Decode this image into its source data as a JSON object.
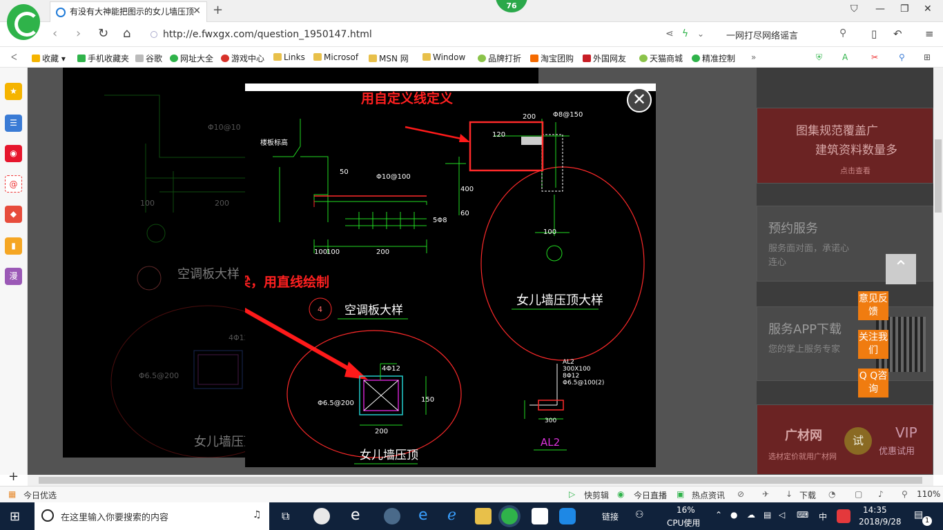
{
  "browser": {
    "tab_title": "有没有大神能把图示的女儿墙压顶",
    "notification_count": "76",
    "url": "http://e.fwxgx.com/question_1950147.html",
    "search_hint": "一网打尽网络谣言"
  },
  "bookmarks": [
    {
      "label": "收藏",
      "icon": "star-icon",
      "color": "#f5b400"
    },
    {
      "label": "手机收藏夹",
      "icon": "phone-icon",
      "color": "#2fb34a"
    },
    {
      "label": "谷歌",
      "icon": "page-icon",
      "color": "#bbbbbb"
    },
    {
      "label": "网址大全",
      "icon": "globe-icon",
      "color": "#2fb34a"
    },
    {
      "label": "游戏中心",
      "icon": "game-icon",
      "color": "#d8322a"
    },
    {
      "label": "Links",
      "icon": "folder-icon",
      "color": "#e8c04a"
    },
    {
      "label": "Microsof",
      "icon": "folder-icon",
      "color": "#e8c04a"
    },
    {
      "label": "MSN 网",
      "icon": "folder-icon",
      "color": "#e8c04a"
    },
    {
      "label": "Window",
      "icon": "folder-icon",
      "color": "#e8c04a"
    },
    {
      "label": "品牌打折",
      "icon": "leaf-icon",
      "color": "#8bc34a"
    },
    {
      "label": "淘宝团购",
      "icon": "taobao-icon",
      "color": "#f56a00"
    },
    {
      "label": "外国网友",
      "icon": "bookmark-icon",
      "color": "#c81d25"
    },
    {
      "label": "天猫商城",
      "icon": "leaf-icon",
      "color": "#8bc34a"
    },
    {
      "label": "精准控制",
      "icon": "chat-icon",
      "color": "#2fb34a"
    }
  ],
  "sidebar": [
    {
      "icon": "favorites-star-icon",
      "color": "#f5b400",
      "glyph": "★"
    },
    {
      "icon": "news-icon",
      "color": "#3a7bd5",
      "glyph": "☰"
    },
    {
      "icon": "weibo-icon",
      "color": "#e6162d",
      "glyph": "◉"
    },
    {
      "icon": "mail-icon",
      "color": "#ffffff",
      "glyph": "@"
    },
    {
      "icon": "games-icon",
      "color": "#e74c3c",
      "glyph": "◆"
    },
    {
      "icon": "reader-icon",
      "color": "#f5a623",
      "glyph": "▮"
    },
    {
      "icon": "comic-icon",
      "color": "#9b59b6",
      "glyph": "漫"
    }
  ],
  "right_column": {
    "banner1_line1": "图集规范覆盖广",
    "banner1_line2": "建筑资料数量多",
    "banner1_cta": "点击查看",
    "card1_title": "预约服务",
    "card1_sub": "服务面对面，承诺心连心",
    "card2_title": "服务APP下载",
    "card2_sub": "您的掌上服务专家",
    "banner2_brand": "广材网",
    "banner2_sub": "选材定价就用广材网",
    "banner2_badge": "试",
    "banner2_vip": "VIP",
    "banner2_vip_sub": "优惠试用"
  },
  "float_buttons": {
    "feedback": "意见反馈",
    "follow": "关注我们",
    "qq": "Q Q咨询"
  },
  "drawing": {
    "note_custom_line": "用自定义线定义",
    "note_ring_beam": "定义圈梁，用直线绘制",
    "title_parapet_detail": "女儿墙压顶大样",
    "title_ac_panel": "空调板大样",
    "title_parapet_top": "女儿墙压顶",
    "title_al2": "AL2",
    "detail_no": "4",
    "rebar_top": "Φ8@150",
    "rebar_ac": "Φ10@100",
    "rebar_ac_bg": "Φ10@10",
    "rebar_stirrup": "Φ6.5@200",
    "rebar_main": "4Φ12",
    "dim_200": "200",
    "dim_100a": "100",
    "dim_100b": "100",
    "dim_400": "400",
    "dim_60": "60",
    "dim_120": "120",
    "dim_150": "150",
    "dim_300": "300",
    "dim_50": "50",
    "dim_small": "5Φ8",
    "al2_spec1": "AL2",
    "al2_spec2": "300X100",
    "al2_spec3": "8Φ12",
    "al2_spec4": "Φ6.5@100(2)",
    "label_floor": "楼板标高"
  },
  "statusbar": {
    "left": "今日优选",
    "items": [
      "快剪辑",
      "今日直播",
      "热点资讯",
      "下载"
    ],
    "zoom": "110%"
  },
  "taskbar": {
    "search_placeholder": "在这里输入你要搜索的内容",
    "link_label": "链接",
    "cpu_percent": "16%",
    "cpu_label": "CPU使用",
    "ime": "中",
    "time": "14:35",
    "date": "2018/9/28",
    "notif_count": "1"
  },
  "colors": {
    "brand_green": "#2fb34a",
    "cad_red": "#ff2a2a",
    "cad_green": "#22dd22",
    "cad_cyan": "#22cccc",
    "cad_magenta": "#cc22cc",
    "orange": "#f07c10"
  }
}
